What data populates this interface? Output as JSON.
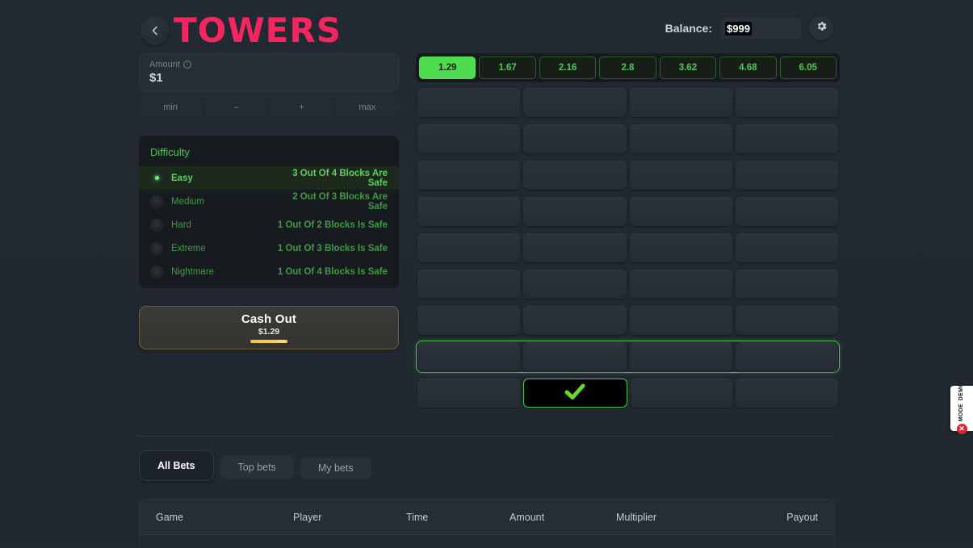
{
  "header": {
    "back_icon": "chevron-left-icon",
    "title": "TOWERS",
    "balance_label": "Balance:",
    "balance_value": "$999",
    "settings_icon": "gear-icon"
  },
  "bet": {
    "amount_label": "Amount",
    "info_icon": "info-icon",
    "amount_value": "$1",
    "buttons": [
      {
        "label": "min",
        "name": "amount-min-button"
      },
      {
        "label": "–",
        "name": "amount-decrease-button"
      },
      {
        "label": "+",
        "name": "amount-increase-button"
      },
      {
        "label": "max",
        "name": "amount-max-button"
      }
    ]
  },
  "difficulty": {
    "title": "Difficulty",
    "options": [
      {
        "name": "Easy",
        "desc": "3 Out Of 4 Blocks Are Safe",
        "selected": true
      },
      {
        "name": "Medium",
        "desc": "2 Out Of 3 Blocks Are Safe",
        "selected": false
      },
      {
        "name": "Hard",
        "desc": "1 Out Of 2 Blocks Is Safe",
        "selected": false
      },
      {
        "name": "Extreme",
        "desc": "1 Out Of 3 Blocks Is Safe",
        "selected": false
      },
      {
        "name": "Nightmare",
        "desc": "1 Out Of 4 Blocks Is Safe",
        "selected": false
      }
    ]
  },
  "cashout": {
    "label": "Cash Out",
    "value": "$1.29"
  },
  "game": {
    "multipliers": [
      {
        "value": "1.29",
        "active": true
      },
      {
        "value": "1.67",
        "active": false
      },
      {
        "value": "2.16",
        "active": false
      },
      {
        "value": "2.8",
        "active": false
      },
      {
        "value": "3.62",
        "active": false
      },
      {
        "value": "4.68",
        "active": false
      },
      {
        "value": "6.05",
        "active": false
      }
    ],
    "rows": 9,
    "columns": 4,
    "current_row_index": 7,
    "revealed": {
      "row": 8,
      "col": 1,
      "icon": "check-icon"
    }
  },
  "bets": {
    "tabs": [
      {
        "label": "All Bets",
        "active": true
      },
      {
        "label": "Top bets",
        "active": false
      },
      {
        "label": "My bets",
        "active": false
      }
    ],
    "columns": [
      "Game",
      "Player",
      "Time",
      "Amount",
      "Multiplier",
      "Payout"
    ]
  },
  "demo": {
    "line1": "DEMO",
    "line2": "MODE",
    "icon": "close-circle-icon",
    "mark": "✕"
  },
  "colors": {
    "brand_pink": "#f5265f",
    "accent_green": "#4fdd4f",
    "gold": "#f3c13a",
    "background": "#222932",
    "panel": "#272d36",
    "danger_red": "#e0242e"
  }
}
